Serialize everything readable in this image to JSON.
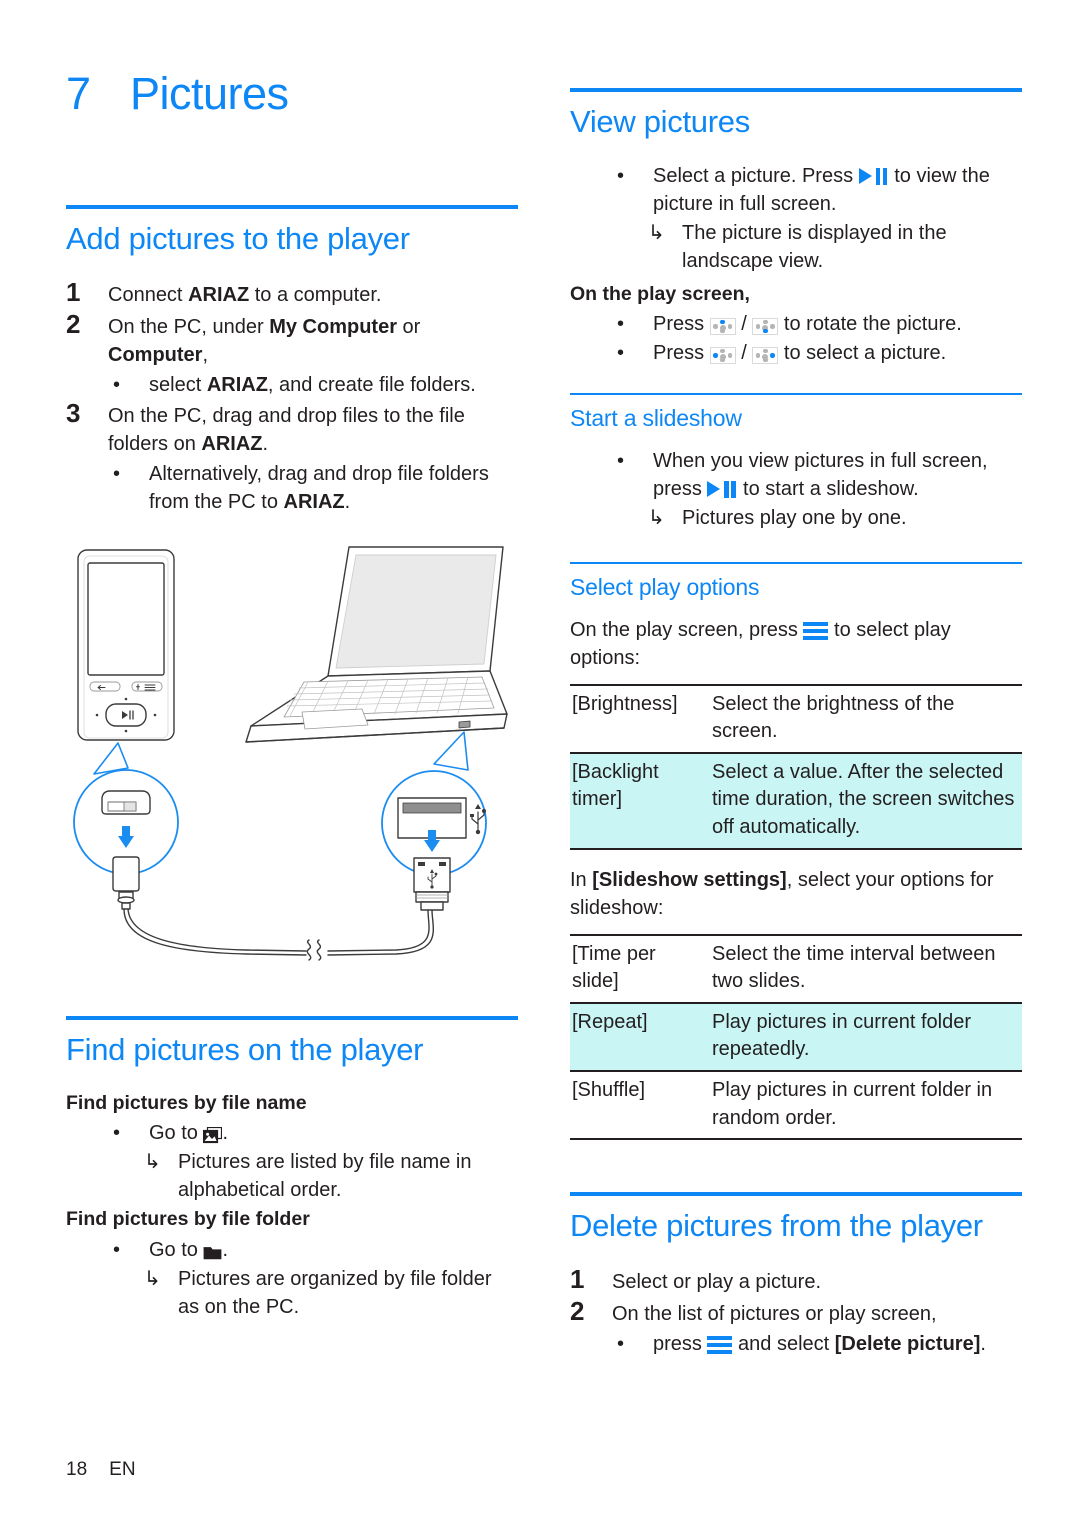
{
  "document": {
    "chapter_number": "7",
    "chapter_title": "Pictures",
    "footer_page": "18",
    "footer_lang": "EN",
    "accent_color": "#0d87f5",
    "highlight_color": "#c9f5f5",
    "text_color": "#231f20"
  },
  "left_column": {
    "add_pictures": {
      "heading": "Add pictures to the player",
      "step1_num": "1",
      "step1_text_a": "Connect ",
      "step1_bold": "ARIAZ",
      "step1_text_b": " to a computer.",
      "step2_num": "2",
      "step2_text_a": "On the PC, under ",
      "step2_bold1": "My Computer",
      "step2_text_b": " or ",
      "step2_bold2": "Computer",
      "step2_text_c": ",",
      "step2_bullet_a": "select ",
      "step2_bullet_bold": "ARIAZ",
      "step2_bullet_b": ", and create file folders.",
      "step3_num": "3",
      "step3_text_a": "On the PC, drag and drop files to the file folders on ",
      "step3_bold": "ARIAZ",
      "step3_text_b": ".",
      "step3_bullet_a": "Alternatively, drag and drop file folders from the PC to ",
      "step3_bullet_bold": "ARIAZ",
      "step3_bullet_b": "."
    },
    "illustration": {
      "name": "connect-player-to-laptop-diagram",
      "description": "ARIAZ player and laptop connected by a USB cable, with magnified callouts of the player's connector socket and the laptop's USB port"
    },
    "find_pictures": {
      "heading": "Find pictures on the player",
      "by_name_heading": "Find pictures by file name",
      "by_name_bullet_a": "Go to ",
      "by_name_bullet_b": ".",
      "by_name_arrow": "Pictures are listed by file name in alphabetical order.",
      "by_folder_heading": "Find pictures by file folder",
      "by_folder_bullet_a": "Go to ",
      "by_folder_bullet_b": ".",
      "by_folder_arrow": "Pictures are organized by file folder as on the PC."
    }
  },
  "right_column": {
    "view_pictures": {
      "heading": "View pictures",
      "bullet1_a": "Select a picture. Press ",
      "bullet1_b": " to view the picture in full screen.",
      "arrow1": "The picture is displayed in the landscape view.",
      "play_screen_heading": "On the play screen,",
      "rotate_a": "Press ",
      "rotate_sep": " / ",
      "rotate_b": " to rotate the picture.",
      "select_a": "Press ",
      "select_sep": " / ",
      "select_b": " to select a picture."
    },
    "start_slideshow": {
      "heading": "Start a slideshow",
      "bullet_a": "When you view pictures in full screen, press ",
      "bullet_b": " to start a slideshow.",
      "arrow": "Pictures play one by one."
    },
    "select_play_options": {
      "heading": "Select play options",
      "intro_a": "On the play screen, press ",
      "intro_b": " to select play options:",
      "table1": [
        {
          "key": "[Brightness]",
          "value": "Select the brightness of the screen.",
          "highlight": false
        },
        {
          "key": "[Backlight timer]",
          "value": "Select a value. After the selected time duration, the screen switches off automatically.",
          "highlight": true
        }
      ],
      "slideshow_intro_a": "In ",
      "slideshow_intro_bold": "[Slideshow settings]",
      "slideshow_intro_b": ", select your options for slideshow:",
      "table2": [
        {
          "key": "[Time per slide]",
          "value": "Select the time interval between two slides.",
          "highlight": false
        },
        {
          "key": "[Repeat]",
          "value": "Play pictures in current folder repeatedly.",
          "highlight": true
        },
        {
          "key": "[Shuffle]",
          "value": "Play pictures in current folder in random order.",
          "highlight": false
        }
      ]
    },
    "delete_pictures": {
      "heading": "Delete pictures from the player",
      "step1_num": "1",
      "step1_text": "Select or play a picture.",
      "step2_num": "2",
      "step2_text": "On the list of pictures or play screen,",
      "step2_bullet_a": "press ",
      "step2_bullet_b": " and select ",
      "step2_bullet_bold": "[Delete picture]",
      "step2_bullet_c": "."
    }
  },
  "icons": {
    "play_pause": "play-pause-icon",
    "menu": "menu-icon",
    "nav_up": "nav-up-icon",
    "nav_down": "nav-down-icon",
    "nav_left": "nav-left-icon",
    "nav_right": "nav-right-icon",
    "photo": "photo-library-icon",
    "folder": "folder-icon",
    "bullet_mark": "•",
    "arrow_mark": "↳"
  }
}
